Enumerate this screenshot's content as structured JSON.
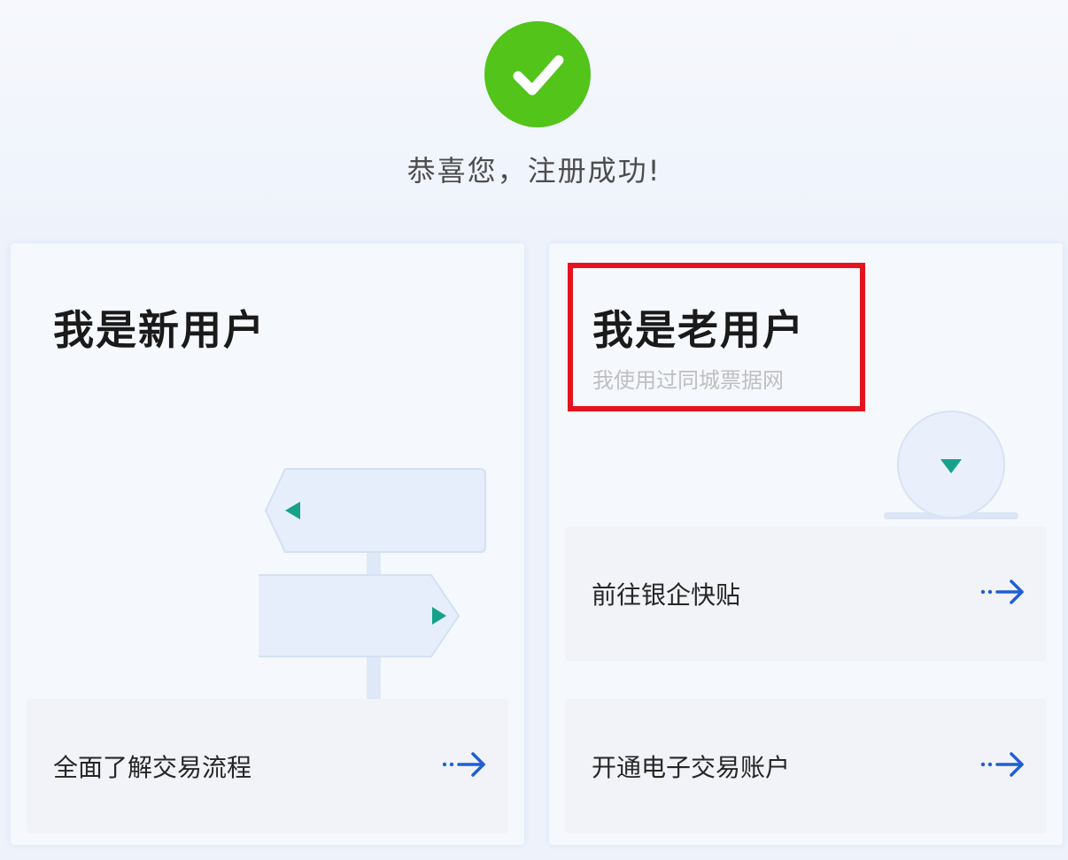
{
  "header": {
    "success_icon": "check-circle-icon",
    "success_color": "#52c41a",
    "message": "恭喜您，注册成功!"
  },
  "new_user_card": {
    "title": "我是新用户",
    "illustration": "signpost-icon",
    "action": {
      "label": "全面了解交易流程",
      "icon": "arrow-right-icon"
    }
  },
  "old_user_card": {
    "title": "我是老用户",
    "subtitle": "我使用过同城票据网",
    "highlight_color": "#e5131d",
    "illustration": "location-pin-icon",
    "actions": [
      {
        "label": "前往银企快贴",
        "icon": "arrow-right-icon"
      },
      {
        "label": "开通电子交易账户",
        "icon": "arrow-right-icon"
      }
    ]
  },
  "accent_color": "#1f5fd6"
}
